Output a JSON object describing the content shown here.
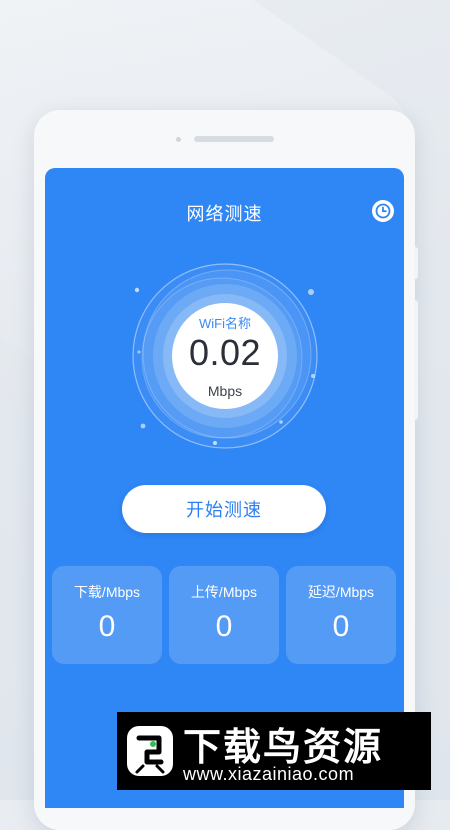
{
  "app": {
    "title": "网络测速",
    "gauge": {
      "network_name": "WiFi名称",
      "speed": "0.02",
      "unit": "Mbps"
    },
    "start_button_label": "开始测速",
    "stats": [
      {
        "label": "下载/Mbps",
        "value": "0"
      },
      {
        "label": "上传/Mbps",
        "value": "0"
      },
      {
        "label": "延迟/Mbps",
        "value": "0"
      }
    ],
    "icons": {
      "history": "clock-icon"
    },
    "colors": {
      "accent": "#2f86f5",
      "button_text": "#2c7ff0"
    }
  },
  "watermark": {
    "brand": "下载鸟资源",
    "url": "www.xiazainiao.com"
  }
}
